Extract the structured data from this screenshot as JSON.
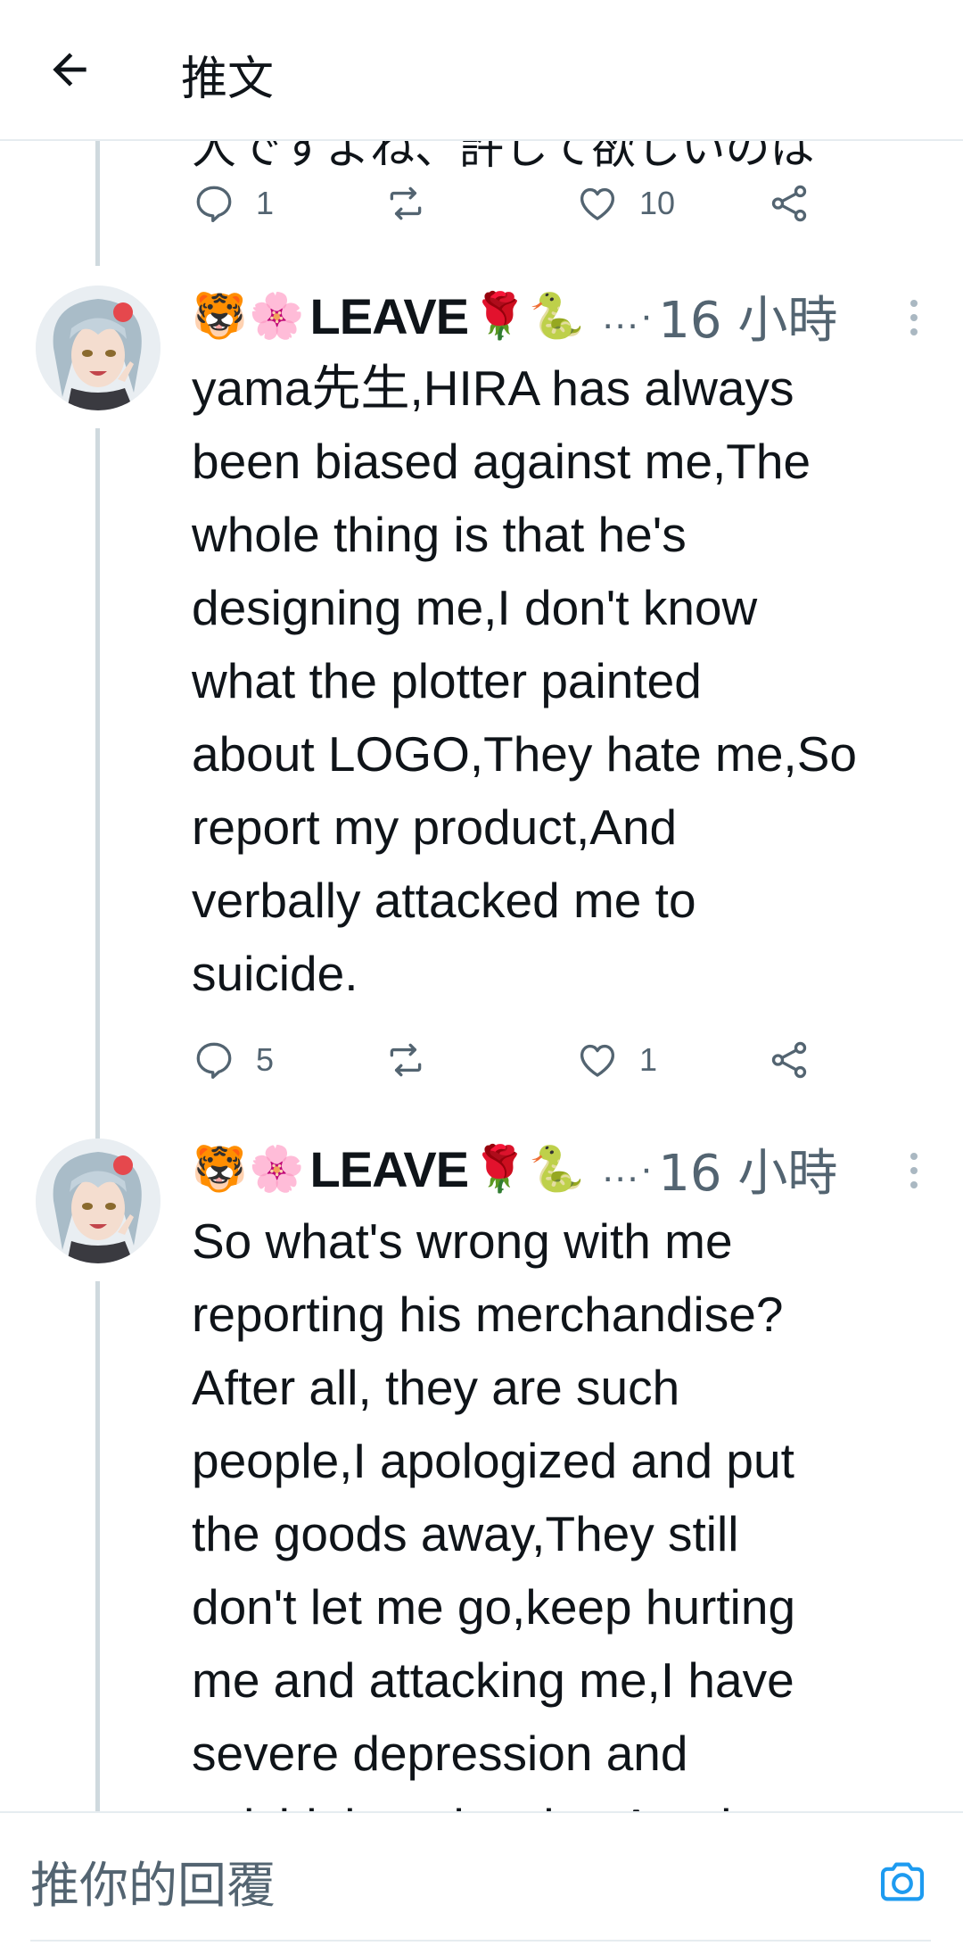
{
  "header": {
    "title": "推文",
    "back_icon": "arrow-left-icon"
  },
  "previous_tweet": {
    "clipped_text": "人ですよね、許して欲しいのは",
    "actions": {
      "replies": "1",
      "likes": "10"
    }
  },
  "tweets": [
    {
      "emojis_before": [
        "🐯",
        "🌸"
      ],
      "display_name": "LEAVE",
      "emojis_after": [
        "🌹",
        "🐍"
      ],
      "ellipsis": "…·",
      "time": "16 小時",
      "text": "yama先生,HIRA has always\nbeen biased against me,The\nwhole thing is that he's\ndesigning me,I don't know\nwhat the plotter painted\nabout LOGO,They hate me,So\nreport my product,And\nverbally attacked me to\nsuicide.",
      "actions": {
        "replies": "5",
        "likes": "1"
      }
    },
    {
      "emojis_before": [
        "🐯",
        "🌸"
      ],
      "display_name": "LEAVE",
      "emojis_after": [
        "🌹",
        "🐍"
      ],
      "ellipsis": "…·",
      "time": "16 小時",
      "text": "So what's wrong with me\nreporting his merchandise?\nAfter all, they are such\npeople,I apologized and put\nthe goods away,They still\ndon't let me go,keep hurting\nme and attacking me,I have\nsevere depression and\nsuicidal tendencies.Another"
    }
  ],
  "reply_bar": {
    "placeholder": "推你的回覆",
    "camera_icon": "camera-icon"
  },
  "colors": {
    "accent": "#1d9bf0",
    "secondary_text": "#536471",
    "thread_line": "#cfd9de"
  }
}
